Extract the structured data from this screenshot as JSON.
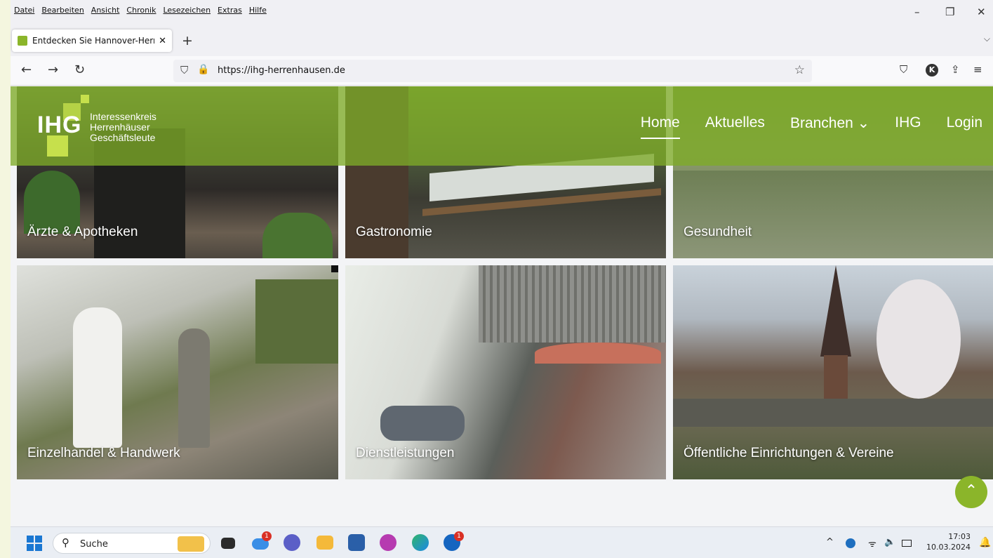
{
  "browser": {
    "menu": [
      "Datei",
      "Bearbeiten",
      "Ansicht",
      "Chronik",
      "Lesezeichen",
      "Extras",
      "Hilfe"
    ],
    "window_controls": {
      "minimize": "–",
      "restore": "❐",
      "close": "✕"
    },
    "tab": {
      "title": "Entdecken Sie Hannover-Herrenhausen",
      "close": "✕"
    },
    "new_tab": "+",
    "tab_list": "⌵",
    "nav": {
      "back": "←",
      "forward": "→",
      "reload": "↻"
    },
    "url": "https://ihg-herrenhausen.de",
    "url_shield": "⛉",
    "url_lock": "🔒",
    "bookmark_star": "☆",
    "pocket": "⛉",
    "account_initial": "K",
    "extensions": "⇪",
    "menu_icon": "≡"
  },
  "site": {
    "logo": {
      "abbr": "IHG",
      "line1": "Interessenkreis",
      "line2": "Herrenhäuser",
      "line3": "Geschäftsleute"
    },
    "nav": [
      {
        "label": "Home",
        "active": true
      },
      {
        "label": "Aktuelles"
      },
      {
        "label": "Branchen ⌄"
      },
      {
        "label": "IHG"
      },
      {
        "label": "Login"
      }
    ],
    "accent": "#8bb52a",
    "tiles": [
      "Ärzte & Apotheken",
      "Gastronomie",
      "Gesundheit",
      "Einzelhandel & Handwerk",
      "Dienstleistungen",
      "Öffentliche Einrichtungen & Vereine"
    ],
    "scroll_top": "⌃"
  },
  "taskbar": {
    "search_label": "Suche",
    "badges": {
      "onedrive": "1",
      "outlook": "1"
    },
    "tray": {
      "chevron": "^",
      "wifi": "ᯤ",
      "volume": "🔈"
    },
    "time": "17:03",
    "date": "10.03.2024"
  }
}
